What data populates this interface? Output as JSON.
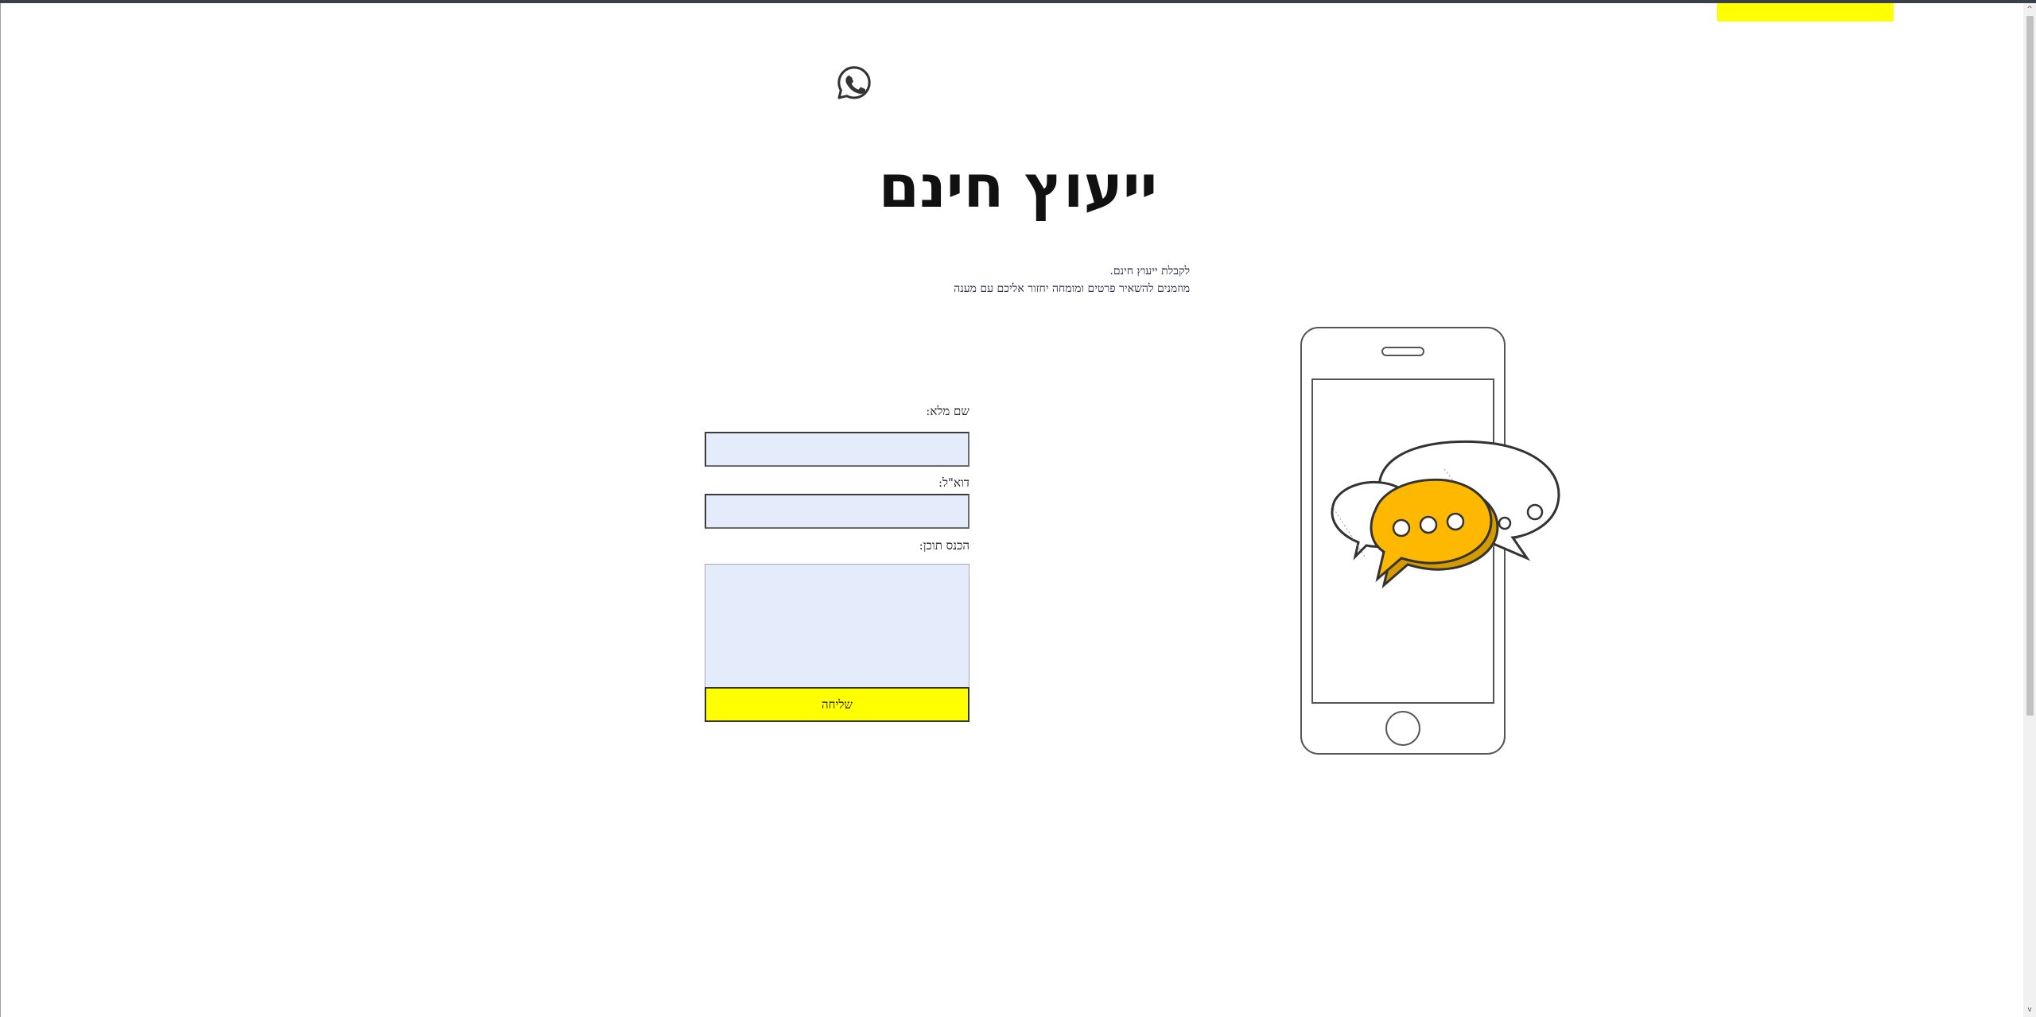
{
  "page": {
    "title": "ייעוץ חינם",
    "subtitle_line1": "לקבלת ייעוץ חינם.",
    "subtitle_line2": "מוזמנים להשאיר פרטים ומומחה יחזור אליכם עם מענה"
  },
  "header": {
    "whatsapp_icon": "whatsapp-icon",
    "accent_tab_color": "#ffff00"
  },
  "form": {
    "name_label": "שם מלא:",
    "name_value": "",
    "email_label": "דוא\"ל:",
    "email_value": "",
    "content_label": "הכנס תוכן:",
    "content_value": "",
    "submit_label": "שליחה",
    "field_background": "#e4ecfc",
    "submit_background": "#ffff00"
  },
  "illustration": {
    "icon": "phone-chat-bubbles-illustration",
    "bubble_color": "#ffb800"
  },
  "scrollbar": {
    "up_icon": "chevron-up-icon",
    "down_icon": "chevron-down-icon",
    "up_glyph": "^",
    "down_glyph": "v"
  }
}
